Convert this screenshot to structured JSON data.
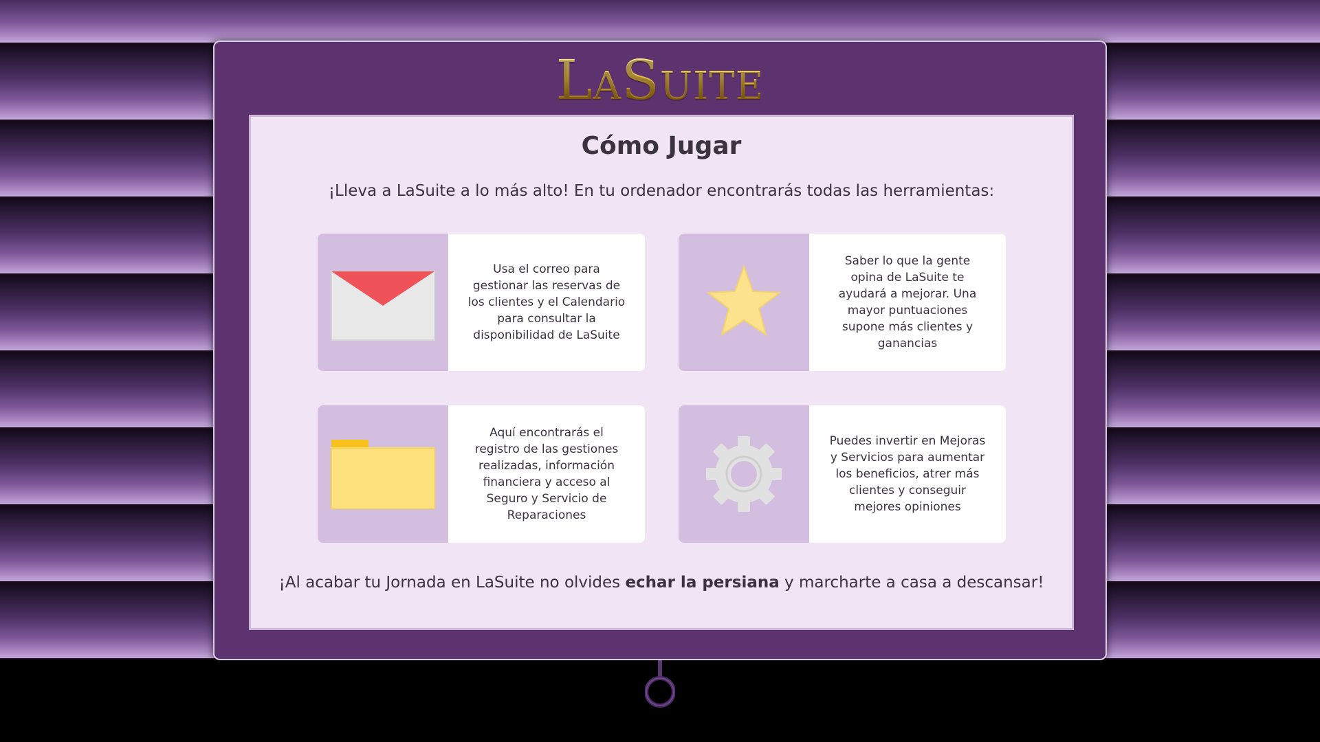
{
  "logo": "LaSuite",
  "heading": "Cómo Jugar",
  "intro": "¡Lleva a LaSuite a lo más alto! En tu ordenador encontrarás todas las herramientas:",
  "cards": [
    {
      "icon": "envelope-icon",
      "text": "Usa el correo para gestionar las reservas de los clientes y el Calendario para consultar la disponibilidad de LaSuite"
    },
    {
      "icon": "star-icon",
      "text": "Saber lo que la gente opina de LaSuite te ayudará a mejorar. Una mayor puntuaciones supone más clientes y ganancias"
    },
    {
      "icon": "folder-icon",
      "text": "Aquí encontrarás el registro de las gestiones realizadas, información financiera y acceso al Seguro y Servicio de Reparaciones"
    },
    {
      "icon": "gear-icon",
      "text": "Puedes invertir en Mejoras y Servicios para aumentar los beneficios, atrer más clientes y conseguir mejores opiniones"
    }
  ],
  "footer": {
    "before": "¡Al acabar tu Jornada en LaSuite no olvides ",
    "bold": "echar la persiana",
    "after": " y marcharte a casa a descansar!"
  },
  "colors": {
    "panel": "#5c336f",
    "content_bg": "#f1e4f5",
    "icon_bg": "#d3bedf",
    "envelope_flap": "#f0525a",
    "star": "#fce28c",
    "folder": "#fde17d",
    "gear": "#e1e1e1"
  }
}
